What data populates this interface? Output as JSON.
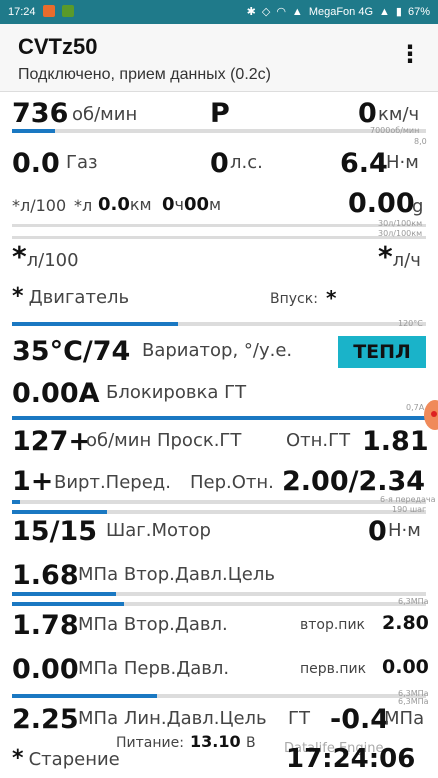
{
  "status": {
    "time": "17:24",
    "carrier": "MegaFon 4G",
    "battery": "67%",
    "icons": [
      "bluetooth-icon",
      "silent-icon",
      "wifi-icon",
      "signal-icon",
      "battery-icon"
    ]
  },
  "app": {
    "title": "CVTz50",
    "subtitle": "Подключено, прием данных (0.2с)",
    "menu_icon": "⋮"
  },
  "r1": {
    "rpm": "736",
    "rpm_unit": "об/мин",
    "gear": "P",
    "speed": "0",
    "speed_unit": "км/ч",
    "max_rpm": "7000об/мин",
    "max_speed": "8,0",
    "rpm_fill": 0.105
  },
  "r2": {
    "gas": "0.0",
    "gas_label": "Газ",
    "hp": "0",
    "hp_unit": "л.с.",
    "torque": "6.4",
    "torque_unit": "Н·м"
  },
  "r3": {
    "fuel": "*",
    "fuel_unit": "л/100",
    "fuel2": "*",
    "fuel2_unit": "л",
    "dist": "0.0",
    "dist_unit": "км",
    "h": "0",
    "h_unit": "ч",
    "m": "00",
    "m_unit": "м",
    "grams": "0.00",
    "grams_unit": "g",
    "scale_a": "30л/100км",
    "scale_b": "30л/100км"
  },
  "r4": {
    "cons": "*",
    "cons_unit": "л/100",
    "cons2": "*",
    "cons2_unit": "л/ч"
  },
  "r5": {
    "engine": "*",
    "engine_label": "Двигатель",
    "intake_label": "Впуск:",
    "intake": "*",
    "max_temp": "120°C",
    "engine_fill": 0.4
  },
  "r6": {
    "temp": "35°C/74",
    "label": "Вариатор, °/у.е.",
    "button": "ТЕПЛ"
  },
  "r7": {
    "current": "0.00A",
    "label": "Блокировка ГТ",
    "max_a": "0,7A",
    "lock_fill": 1.0
  },
  "r8": {
    "slip": "127+",
    "slip_unit": "об/мин",
    "slip_label": "Проск.ГТ",
    "ratio_label": "Отн.ГТ",
    "ratio": "1.81"
  },
  "r9": {
    "virt": "1+",
    "virt_label": "Вирт.Перед.",
    "per_label": "Пер.Отн.",
    "per": "2.00/2.34",
    "gear_max": "6-я передача",
    "virt_fill": 0.02
  },
  "r10": {
    "step": "15/15",
    "step_label": "Шаг.Мотор",
    "nm": "0",
    "nm_unit": "Н·м",
    "step_max": "190 шаг",
    "step_fill": 0.23
  },
  "r11": {
    "value": "1.68",
    "unit": "МПа",
    "label": "Втор.Давл.Цель",
    "max": "6,3МПа",
    "fill_a": 0.25,
    "fill_b": 0.27
  },
  "r12": {
    "value": "1.78",
    "unit": "МПа",
    "label": "Втор.Давл.",
    "peak_label": "втор.пик",
    "peak": "2.80"
  },
  "r13": {
    "value": "0.00",
    "unit": "МПа",
    "label": "Перв.Давл.",
    "peak_label": "перв.пик",
    "peak": "0.00",
    "max": "6,3МПа",
    "fill": 0.35
  },
  "r14": {
    "value": "2.25",
    "unit": "МПа",
    "label": "Лин.Давл.Цель",
    "gt_label": "ГТ",
    "gt": "-0.4",
    "gt_unit": "МПа",
    "power_label": "Питание:",
    "power": "13.10",
    "power_unit": "В",
    "max": "6,3МПа"
  },
  "r15": {
    "aging": "*",
    "aging_label": "Старение",
    "clock": "17:24:06",
    "watermark": "Datalife Engine"
  }
}
